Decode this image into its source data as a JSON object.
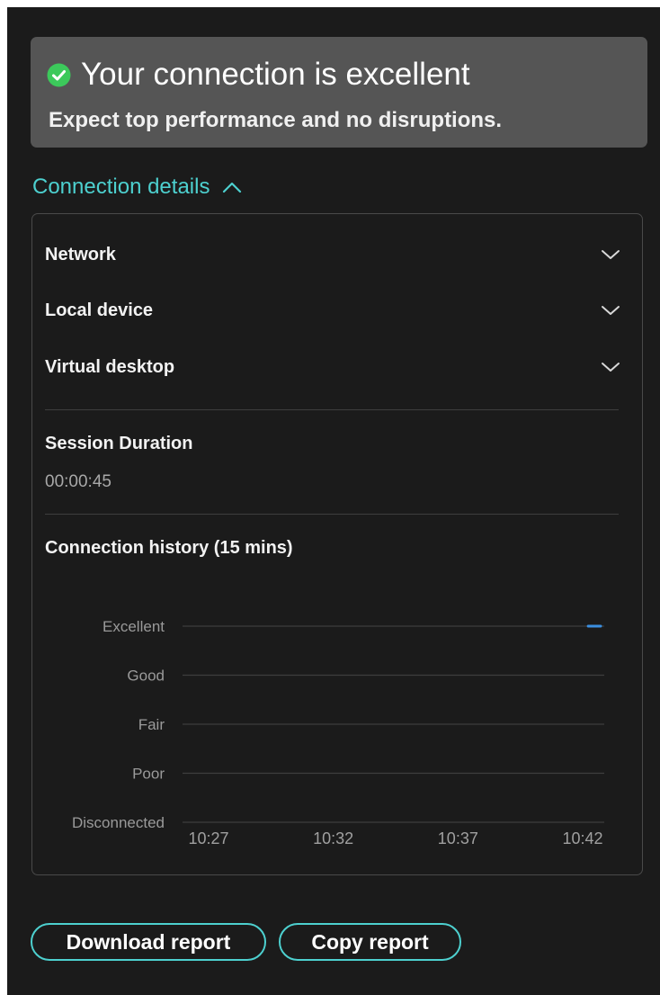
{
  "status": {
    "title": "Your connection is excellent",
    "subtitle": "Expect top performance and no disruptions.",
    "icon": "check-circle-icon",
    "icon_color": "#3cc95b"
  },
  "details": {
    "toggle_label": "Connection details",
    "expanded": true,
    "accordion": [
      {
        "label": "Network"
      },
      {
        "label": "Local device"
      },
      {
        "label": "Virtual desktop"
      }
    ],
    "session": {
      "label": "Session Duration",
      "value": "00:00:45"
    },
    "history": {
      "label": "Connection history (15 mins)"
    }
  },
  "chart_data": {
    "type": "line",
    "title": "",
    "xlabel": "",
    "ylabel": "",
    "y_categories": [
      "Excellent",
      "Good",
      "Fair",
      "Poor",
      "Disconnected"
    ],
    "x_ticks": [
      "10:27",
      "10:32",
      "10:37",
      "10:42"
    ],
    "series": [
      {
        "color": "#3b8fe0",
        "points": [
          {
            "x": "10:41.5",
            "y": "Excellent"
          },
          {
            "x": "10:42",
            "y": "Excellent"
          }
        ]
      }
    ],
    "grid": true,
    "legend": "none"
  },
  "buttons": {
    "download": "Download report",
    "copy": "Copy report"
  },
  "colors": {
    "accent": "#4dd0cf",
    "panel_bg": "#1b1b1b",
    "banner_bg": "#555555",
    "series": "#3b8fe0"
  }
}
